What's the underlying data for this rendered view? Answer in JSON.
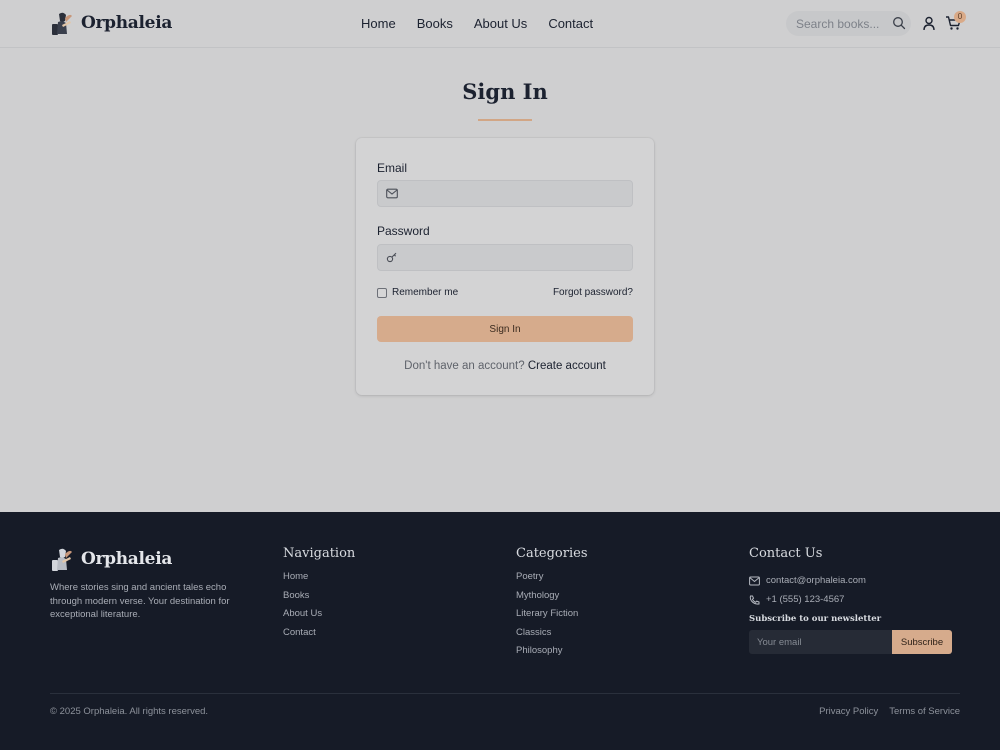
{
  "brand": {
    "name": "Orphaleia"
  },
  "nav": {
    "items": [
      {
        "label": "Home"
      },
      {
        "label": "Books"
      },
      {
        "label": "About Us"
      },
      {
        "label": "Contact"
      }
    ]
  },
  "search": {
    "placeholder": "Search books..."
  },
  "cart": {
    "count": "0"
  },
  "icons": [
    "logo-icon",
    "search-icon",
    "user-icon",
    "cart-icon",
    "mail-icon",
    "key-icon",
    "phone-icon"
  ],
  "signin": {
    "title": "Sign In",
    "email_label": "Email",
    "email_value": "",
    "password_label": "Password",
    "password_value": "",
    "remember_label": "Remember me",
    "remember_checked": false,
    "forgot_label": "Forgot password?",
    "button_label": "Sign In",
    "signup_prompt": "Don't have an account?",
    "signup_link": "Create account"
  },
  "footer": {
    "description": "Where stories sing and ancient tales echo through modern verse. Your destination for exceptional literature.",
    "navigation": {
      "heading": "Navigation",
      "links": [
        {
          "label": "Home"
        },
        {
          "label": "Books"
        },
        {
          "label": "About Us"
        },
        {
          "label": "Contact"
        }
      ]
    },
    "categories": {
      "heading": "Categories",
      "links": [
        {
          "label": "Poetry"
        },
        {
          "label": "Mythology"
        },
        {
          "label": "Literary Fiction"
        },
        {
          "label": "Classics"
        },
        {
          "label": "Philosophy"
        }
      ]
    },
    "contact": {
      "heading": "Contact Us",
      "email": "contact@orphaleia.com",
      "phone": "+1 (555) 123-4567",
      "newsletter_label": "Subscribe to our newsletter",
      "newsletter_placeholder": "Your email",
      "subscribe_label": "Subscribe"
    },
    "copyright": "© 2025 Orphaleia. All rights reserved.",
    "legal": {
      "privacy": "Privacy Policy",
      "terms": "Terms of Service"
    }
  },
  "colors": {
    "accent": "#d6ab8c",
    "footer_bg": "#161b27",
    "page_bg": "#cfcfd0"
  }
}
